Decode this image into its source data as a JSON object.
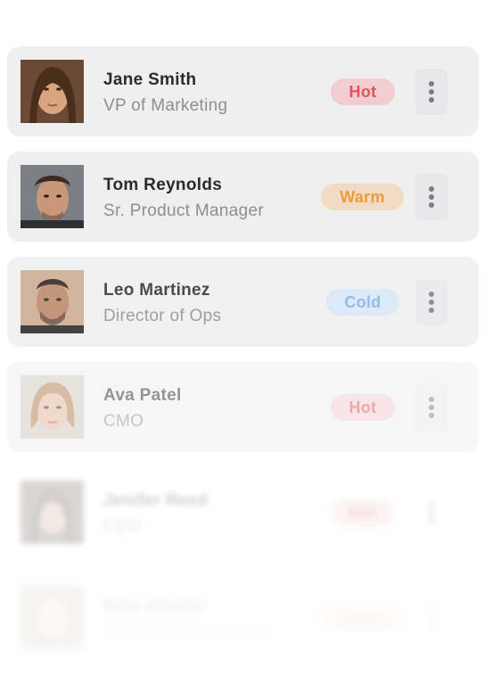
{
  "contacts": [
    {
      "name": "Jane Smith",
      "title": "VP of Marketing",
      "status": "Hot",
      "status_level": "hot"
    },
    {
      "name": "Tom Reynolds",
      "title": "Sr. Product Manager",
      "status": "Warm",
      "status_level": "warm"
    },
    {
      "name": "Leo Martinez",
      "title": "Director of Ops",
      "status": "Cold",
      "status_level": "cold"
    },
    {
      "name": "Ava Patel",
      "title": "CMO",
      "status": "Hot",
      "status_level": "hot"
    },
    {
      "name": "Jenifer Reed",
      "title": "CEO",
      "status": "Hot",
      "status_level": "hot"
    },
    {
      "name": "Nina Alvarez",
      "title": "Head of Partnerships",
      "status": "Warm",
      "status_level": "warm"
    }
  ],
  "colors": {
    "card_background": "#efeff0",
    "hot_text": "#e5505c",
    "hot_bg": "#f2cdd0",
    "warm_text": "#ef9b3c",
    "warm_bg": "#f1dcc3",
    "cold_text": "#7fb2e3",
    "cold_bg": "#d6e7f6"
  },
  "icons": {
    "menu": "more-vertical-icon",
    "avatar": "avatar-photo"
  }
}
